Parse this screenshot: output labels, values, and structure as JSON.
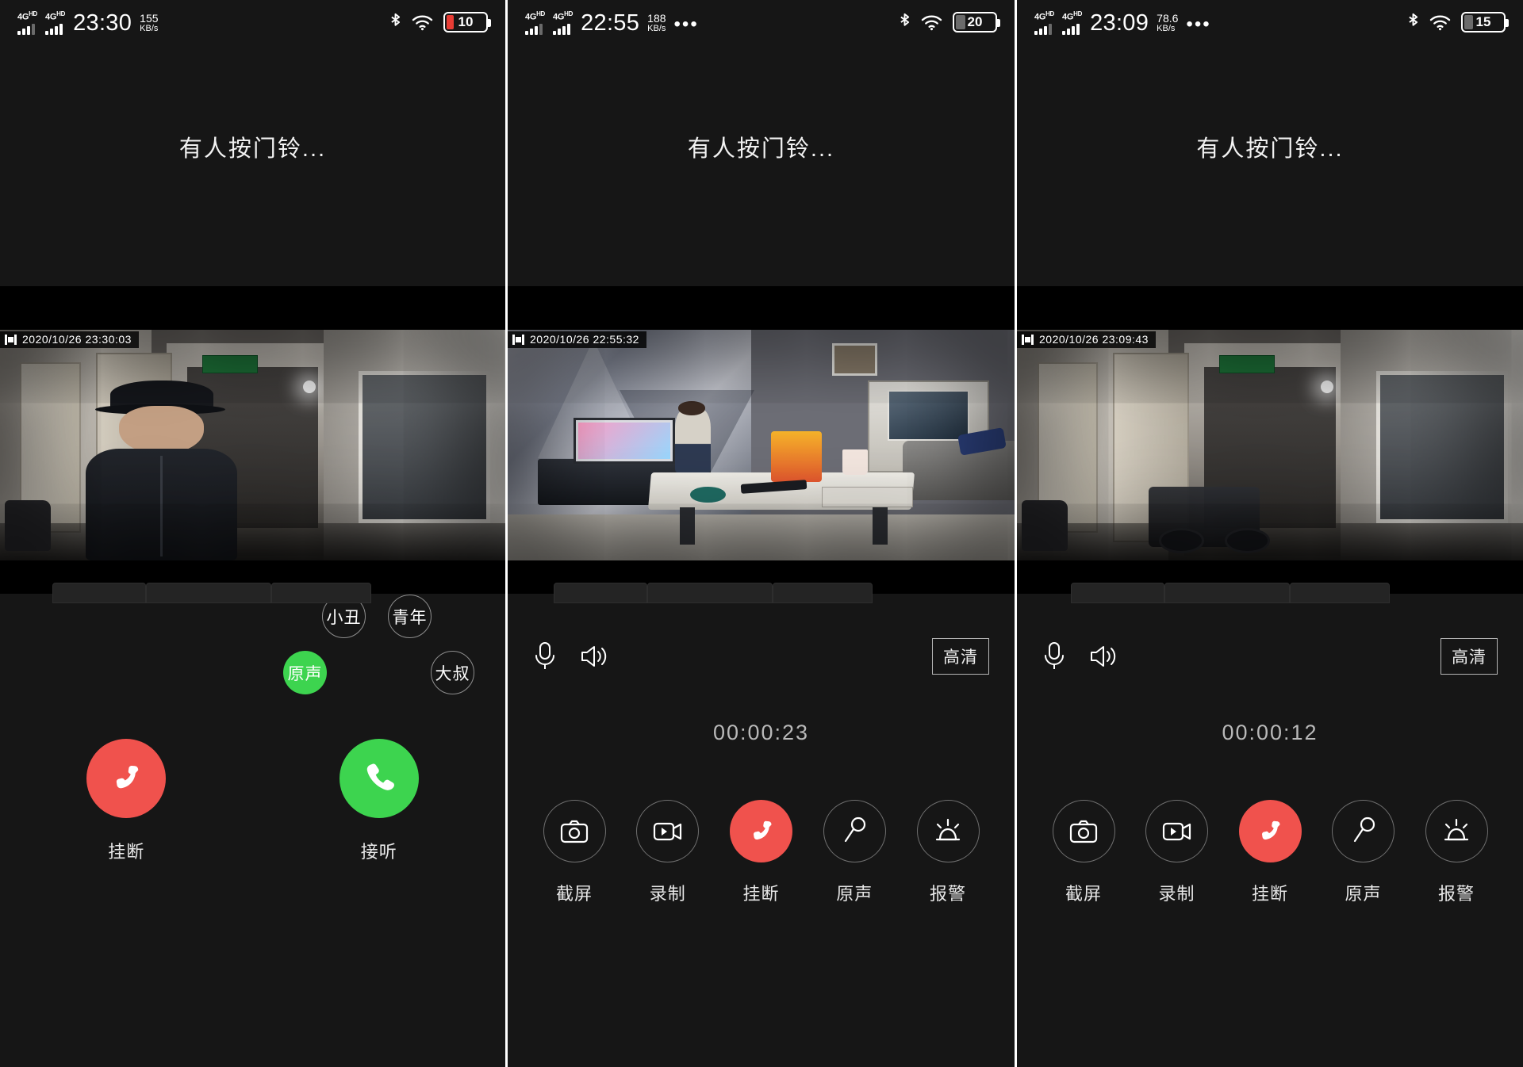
{
  "app": {
    "ringing_text": "有人按门铃...",
    "accent_red": "#f0524d",
    "accent_green": "#3dd44f",
    "background": "#161616"
  },
  "panels": [
    {
      "name": "incoming-call",
      "statusbar": {
        "network_label_1": "4G",
        "network_sup_1": "HD",
        "network_label_2": "4G",
        "network_sup_2": "HD",
        "clock": "23:30",
        "speed_value": "155",
        "speed_unit": "KB/s",
        "overflow": "",
        "bluetooth_icon": "bluetooth-icon",
        "wifi_icon": "wifi-icon",
        "battery_percent": "10",
        "battery_color": "#e83c34"
      },
      "ring_text": "有人按门铃...",
      "video_stamp": "2020/10/26  23:30:03",
      "call": {
        "hangup_label": "挂断",
        "answer_label": "接听",
        "hangup_icon": "phone-hangup-icon",
        "answer_icon": "phone-answer-icon"
      },
      "voice_options": [
        {
          "label": "小丑",
          "active": false
        },
        {
          "label": "青年",
          "active": false
        },
        {
          "label": "原声",
          "active": true
        },
        {
          "label": "大叔",
          "active": false
        }
      ]
    },
    {
      "name": "active-call-room",
      "statusbar": {
        "network_label_1": "4G",
        "network_sup_1": "HD",
        "network_label_2": "4G",
        "network_sup_2": "HD",
        "clock": "22:55",
        "speed_value": "188",
        "speed_unit": "KB/s",
        "overflow": "•••",
        "bluetooth_icon": "bluetooth-icon",
        "wifi_icon": "wifi-icon",
        "battery_percent": "20",
        "battery_color": "#6b6b6b"
      },
      "ring_text": "有人按门铃...",
      "video_stamp": "2020/10/26  22:55:32",
      "toolbar": {
        "mic_icon": "microphone-icon",
        "speaker_icon": "speaker-icon",
        "quality_label": "高清"
      },
      "timer": "00:00:23",
      "actions": [
        {
          "label": "截屏",
          "icon": "camera-icon",
          "style": "outline"
        },
        {
          "label": "录制",
          "icon": "video-record-icon",
          "style": "outline"
        },
        {
          "label": "挂断",
          "icon": "phone-hangup-icon",
          "style": "danger"
        },
        {
          "label": "原声",
          "icon": "microphone-voice-icon",
          "style": "outline"
        },
        {
          "label": "报警",
          "icon": "alarm-siren-icon",
          "style": "outline"
        }
      ]
    },
    {
      "name": "active-call-corridor",
      "statusbar": {
        "network_label_1": "4G",
        "network_sup_1": "HD",
        "network_label_2": "4G",
        "network_sup_2": "HD",
        "clock": "23:09",
        "speed_value": "78.6",
        "speed_unit": "KB/s",
        "overflow": "•••",
        "bluetooth_icon": "bluetooth-icon",
        "wifi_icon": "wifi-icon",
        "battery_percent": "15",
        "battery_color": "#6b6b6b"
      },
      "ring_text": "有人按门铃...",
      "video_stamp": "2020/10/26  23:09:43",
      "toolbar": {
        "mic_icon": "microphone-icon",
        "speaker_icon": "speaker-icon",
        "quality_label": "高清"
      },
      "timer": "00:00:12",
      "actions": [
        {
          "label": "截屏",
          "icon": "camera-icon",
          "style": "outline"
        },
        {
          "label": "录制",
          "icon": "video-record-icon",
          "style": "outline"
        },
        {
          "label": "挂断",
          "icon": "phone-hangup-icon",
          "style": "danger"
        },
        {
          "label": "原声",
          "icon": "microphone-voice-icon",
          "style": "outline"
        },
        {
          "label": "报警",
          "icon": "alarm-siren-icon",
          "style": "outline"
        }
      ]
    }
  ]
}
